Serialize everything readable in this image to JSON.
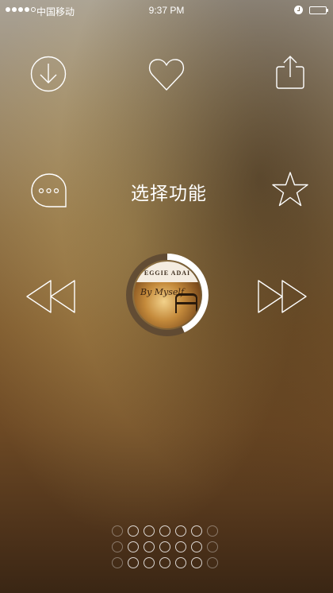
{
  "status_bar": {
    "carrier": "中国移动",
    "time": "9:37 PM",
    "signal_strength": 4,
    "signal_max": 5
  },
  "actions": {
    "download_icon": "download-icon",
    "favorite_icon": "heart-icon",
    "share_icon": "share-icon",
    "comment_icon": "comment-icon",
    "star_icon": "star-icon"
  },
  "title": "选择功能",
  "player": {
    "rewind_icon": "rewind-icon",
    "fast_forward_icon": "fast-forward-icon",
    "album": {
      "artist": "EGGIE ADAI",
      "title": "By Myself"
    }
  }
}
